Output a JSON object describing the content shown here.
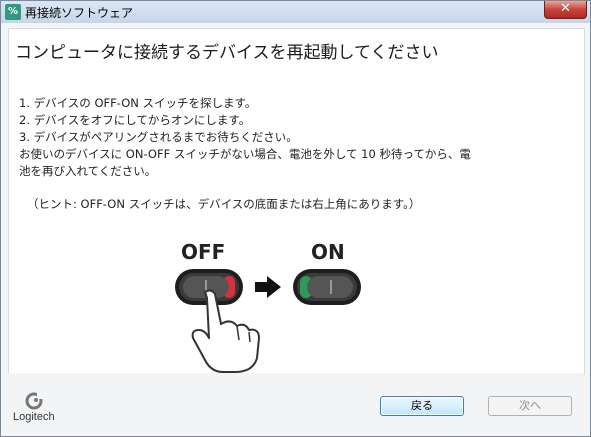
{
  "window": {
    "title": "再接続ソフトウェア",
    "close_symbol": "✕",
    "icon": "logitech-app-icon"
  },
  "main": {
    "heading": "コンピュータに接続するデバイスを再起動してください",
    "steps": [
      "1. デバイスの OFF-ON スイッチを探します。",
      "2. デバイスをオフにしてからオンにします。",
      "3. デバイスがペアリングされるまでお待ちください。",
      "お使いのデバイスに ON-OFF スイッチがない場合、電池を外して 10 秒待ってから、電",
      "池を再び入れてください。"
    ],
    "hint": "（ヒント: OFF-ON スイッチは、デバイスの底面または右上角にあります。）",
    "illustration": {
      "off_label": "OFF",
      "on_label": "ON",
      "off_color": "#d9303c",
      "on_color": "#2e9a5a"
    }
  },
  "footer": {
    "logo_text": "Logitech",
    "back_label": "戻る",
    "next_label": "次へ"
  }
}
